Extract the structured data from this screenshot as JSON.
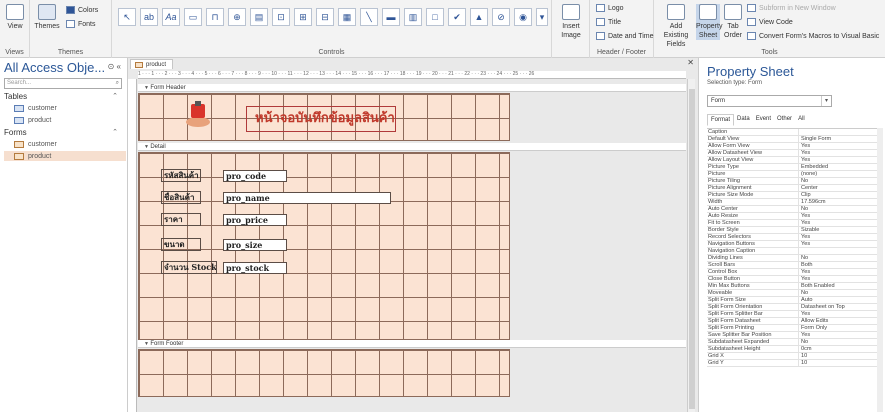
{
  "ribbon": {
    "views": {
      "view": "View",
      "group": "Views"
    },
    "themes": {
      "themes": "Themes",
      "colors": "Colors",
      "fonts": "Fonts",
      "group": "Themes"
    },
    "controls": {
      "group": "Controls",
      "insert_image": "Insert Image"
    },
    "header_footer": {
      "logo": "Logo",
      "title": "Title",
      "date_time": "Date and Time",
      "group": "Header / Footer"
    },
    "tools": {
      "add_fields": "Add Existing Fields",
      "property_sheet": "Property Sheet",
      "tab_order": "Tab Order",
      "subform": "Subform in New Window",
      "view_code": "View Code",
      "convert_macros": "Convert Form's Macros to Visual Basic",
      "group": "Tools"
    }
  },
  "nav": {
    "title": "All Access Obje...",
    "search_placeholder": "Search...",
    "sections": [
      {
        "label": "Tables",
        "items": [
          "customer",
          "product"
        ]
      },
      {
        "label": "Forms",
        "items": [
          "customer",
          "product"
        ]
      }
    ]
  },
  "document": {
    "tab": "product",
    "sections": {
      "header": "Form Header",
      "detail": "Detail",
      "footer": "Form Footer"
    },
    "title": "หน้าจอบันทึกข้อมูลสินค้า",
    "fields": [
      {
        "label": "รหัสสินค้า",
        "control": "pro_code"
      },
      {
        "label": "ชื่อสินค้า",
        "control": "pro_name"
      },
      {
        "label": "ราคา",
        "control": "pro_price"
      },
      {
        "label": "ขนาด",
        "control": "pro_size"
      },
      {
        "label": "จำนวน Stock",
        "control": "pro_stock"
      }
    ],
    "ruler": "1 · · · 1 · · · 2 · · · 3 · · · 4 · · · 5 · · · 6 · · · 7 · · · 8 · · · 9 · · · 10 · · · 11 · · · 12 · · · 13 · · · 14 · · · 15 · · · 16 · · · 17 · · · 18 · · · 19 · · · 20 · · · 21 · · · 22 · · · 23 · · · 24 · · · 25 · · · 26"
  },
  "property_sheet": {
    "title": "Property Sheet",
    "selection_type": "Selection type:  Form",
    "selected": "Form",
    "tabs": [
      "Format",
      "Data",
      "Event",
      "Other",
      "All"
    ],
    "rows": [
      [
        "Caption",
        ""
      ],
      [
        "Default View",
        "Single Form"
      ],
      [
        "Allow Form View",
        "Yes"
      ],
      [
        "Allow Datasheet View",
        "Yes"
      ],
      [
        "Allow Layout View",
        "Yes"
      ],
      [
        "Picture Type",
        "Embedded"
      ],
      [
        "Picture",
        "(none)"
      ],
      [
        "Picture Tiling",
        "No"
      ],
      [
        "Picture Alignment",
        "Center"
      ],
      [
        "Picture Size Mode",
        "Clip"
      ],
      [
        "Width",
        "17.596cm"
      ],
      [
        "Auto Center",
        "No"
      ],
      [
        "Auto Resize",
        "Yes"
      ],
      [
        "Fit to Screen",
        "Yes"
      ],
      [
        "Border Style",
        "Sizable"
      ],
      [
        "Record Selectors",
        "Yes"
      ],
      [
        "Navigation Buttons",
        "Yes"
      ],
      [
        "Navigation Caption",
        ""
      ],
      [
        "Dividing Lines",
        "No"
      ],
      [
        "Scroll Bars",
        "Both"
      ],
      [
        "Control Box",
        "Yes"
      ],
      [
        "Close Button",
        "Yes"
      ],
      [
        "Min Max Buttons",
        "Both Enabled"
      ],
      [
        "Moveable",
        "No"
      ],
      [
        "Split Form Size",
        "Auto"
      ],
      [
        "Split Form Orientation",
        "Datasheet on Top"
      ],
      [
        "Split Form Splitter Bar",
        "Yes"
      ],
      [
        "Split Form Datasheet",
        "Allow Edits"
      ],
      [
        "Split Form Printing",
        "Form Only"
      ],
      [
        "Save Splitter Bar Position",
        "Yes"
      ],
      [
        "Subdatasheet Expanded",
        "No"
      ],
      [
        "Subdatasheet Height",
        "0cm"
      ],
      [
        "Grid X",
        "10"
      ],
      [
        "Grid Y",
        "10"
      ]
    ]
  }
}
